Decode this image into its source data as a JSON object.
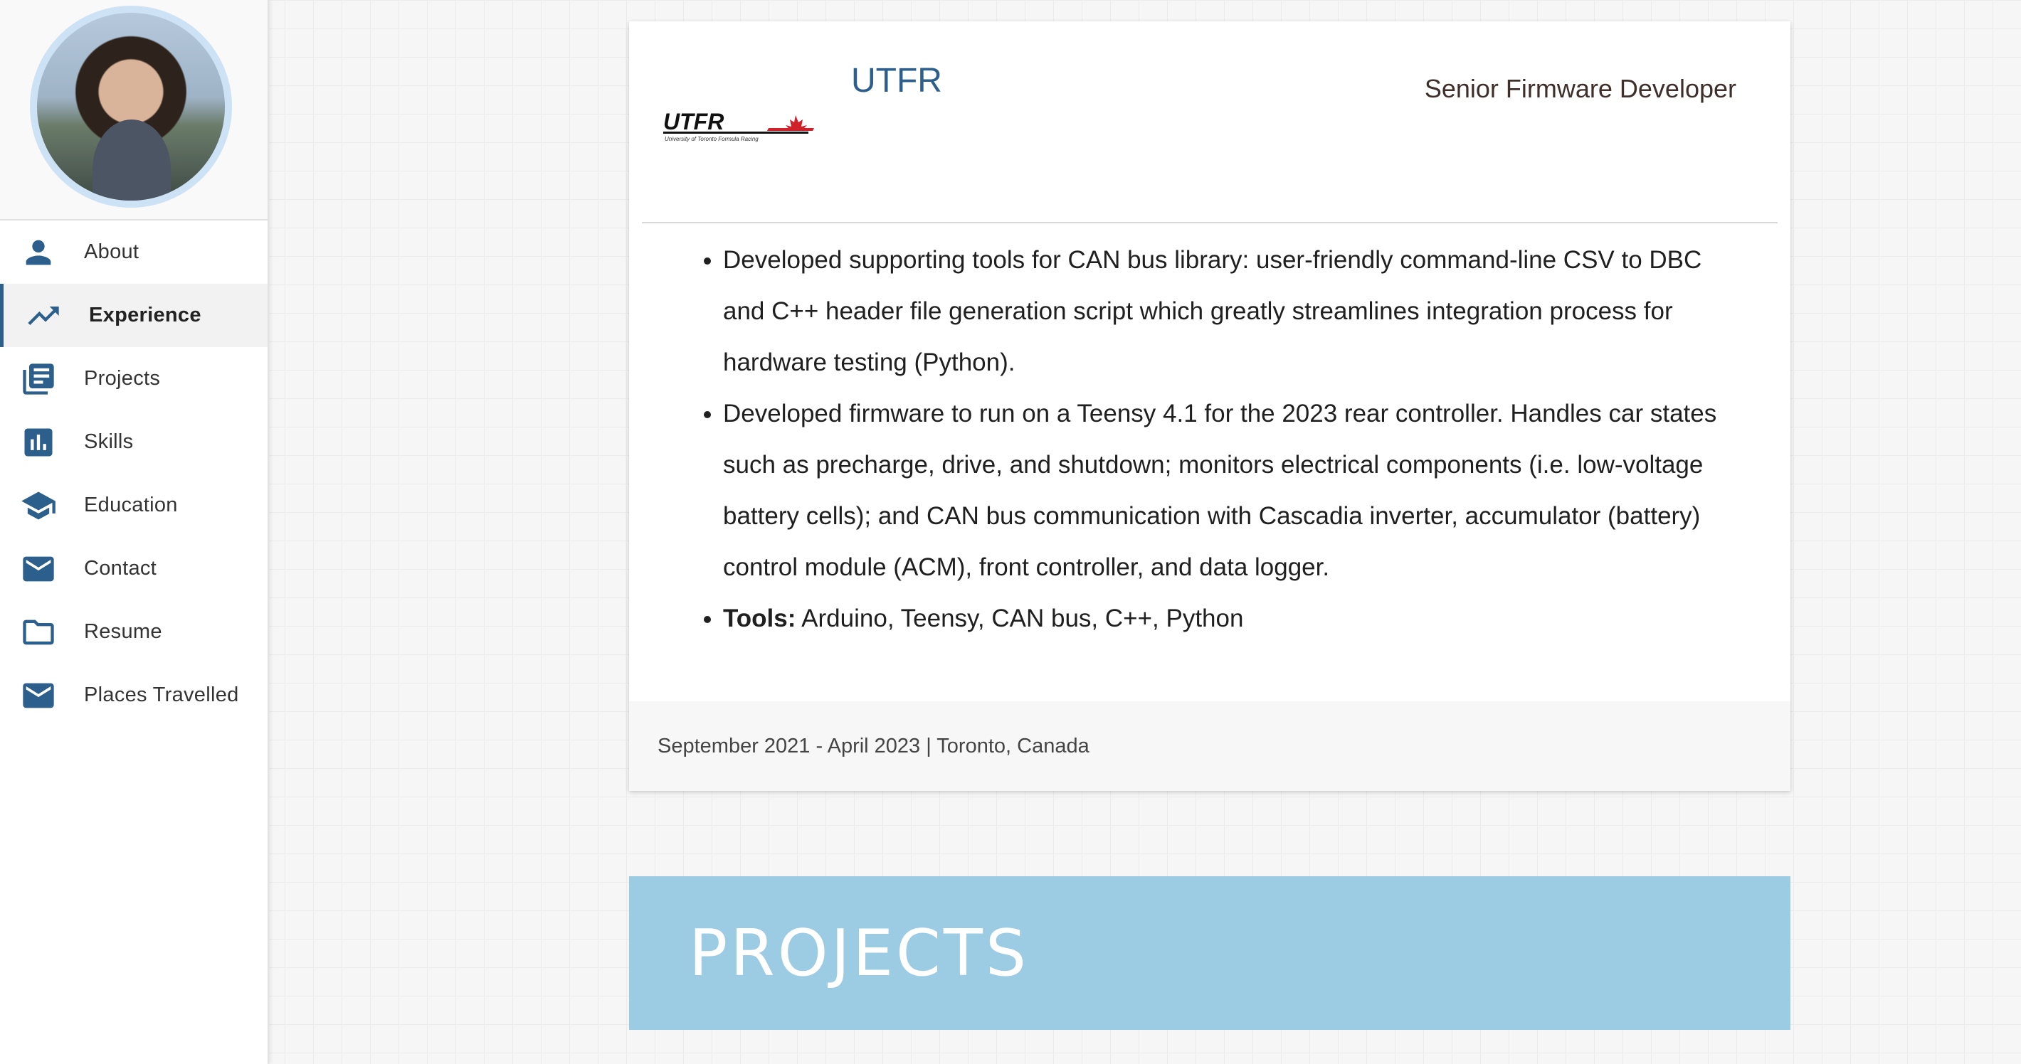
{
  "sidebar": {
    "items": [
      {
        "label": "About",
        "icon": "person-icon",
        "active": false
      },
      {
        "label": "Experience",
        "icon": "trending-up-icon",
        "active": true
      },
      {
        "label": "Projects",
        "icon": "library-books-icon",
        "active": false
      },
      {
        "label": "Skills",
        "icon": "bar-chart-icon",
        "active": false
      },
      {
        "label": "Education",
        "icon": "school-icon",
        "active": false
      },
      {
        "label": "Contact",
        "icon": "mail-icon",
        "active": false
      },
      {
        "label": "Resume",
        "icon": "folder-icon",
        "active": false
      },
      {
        "label": "Places Travelled",
        "icon": "mail-icon",
        "active": false
      }
    ]
  },
  "experience": {
    "company": "UTFR",
    "logo_text": "UTFR",
    "logo_subtext": "University of Toronto Formula Racing",
    "role": "Senior Firmware Developer",
    "bullets": [
      "Developed supporting tools for CAN bus library: user-friendly command-line CSV to DBC and C++ header file generation script which greatly streamlines integration process for hardware testing (Python).",
      "Developed firmware to run on a Teensy 4.1 for the 2023 rear controller. Handles car states such as precharge, drive, and shutdown; monitors electrical components (i.e. low-voltage battery cells); and CAN bus communication with Cascadia inverter, accumulator (battery) control module (ACM), front controller, and data logger."
    ],
    "tools_label": "Tools:",
    "tools_value": " Arduino, Teensy, CAN bus, C++, Python",
    "footer": "September 2021 - April 2023 | Toronto, Canada"
  },
  "projects": {
    "title": "PROJECTS"
  },
  "colors": {
    "accent": "#2c5f8c",
    "banner": "#9ccbe4",
    "logo_red": "#d0202a"
  }
}
